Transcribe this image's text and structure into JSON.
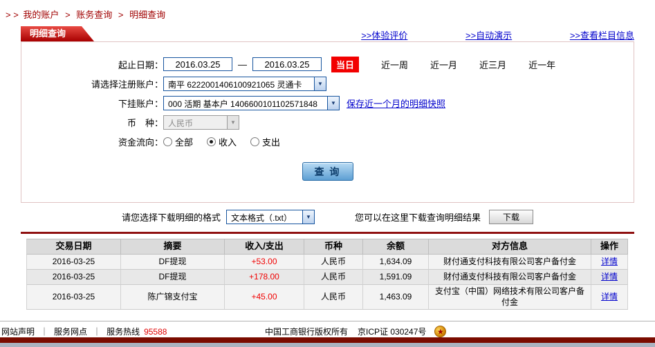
{
  "icons": {
    "dropdown_arrow": "▼",
    "badge_star": "★"
  },
  "breadcrumb": {
    "prefix": "> >",
    "separator": ">",
    "items": [
      "我的账户",
      "账务查询",
      "明细查询"
    ]
  },
  "panel": {
    "title": "明细查询",
    "links": [
      ">>体验评价",
      ">>自动演示",
      ">>查看栏目信息"
    ]
  },
  "form": {
    "date_label": "起止日期：",
    "date_from": "2016.03.25",
    "date_to": "2016.03.25",
    "dash": "—",
    "today_button": "当日",
    "quick_ranges": [
      "近一周",
      "近一月",
      "近三月",
      "近一年"
    ],
    "account_label": "请选择注册账户：",
    "account_value": "南平 6222001406100921065 灵通卡",
    "subaccount_label": "下挂账户：",
    "subaccount_value": "000 活期 基本户 1406600101102571848",
    "snapshot_link": "保存近一个月的明细快照",
    "currency_label": "币　种：",
    "currency_value": "人民币",
    "flow_label": "资金流向：",
    "flow_options": [
      "全部",
      "收入",
      "支出"
    ],
    "flow_selected": "收入",
    "query_button": "查 询"
  },
  "download": {
    "format_label": "请您选择下载明细的格式",
    "format_value": "文本格式（.txt）",
    "hint": "您可以在这里下载查询明细结果",
    "button": "下载"
  },
  "table": {
    "headers": [
      "交易日期",
      "摘要",
      "收入/支出",
      "币种",
      "余额",
      "对方信息",
      "操作"
    ],
    "rows": [
      {
        "date": "2016-03-25",
        "summary": "DF提现",
        "amount": "+53.00",
        "currency": "人民币",
        "balance": "1,634.09",
        "counterparty": "财付通支付科技有限公司客户备付金",
        "action": "详情"
      },
      {
        "date": "2016-03-25",
        "summary": "DF提现",
        "amount": "+178.00",
        "currency": "人民币",
        "balance": "1,591.09",
        "counterparty": "财付通支付科技有限公司客户备付金",
        "action": "详情"
      },
      {
        "date": "2016-03-25",
        "summary": "陈广锦支付宝",
        "amount": "+45.00",
        "currency": "人民币",
        "balance": "1,463.09",
        "counterparty": "支付宝（中国）网络技术有限公司客户备付金",
        "action": "详情"
      }
    ]
  },
  "footer": {
    "links": [
      "网站声明",
      "服务网点"
    ],
    "separator": "｜",
    "hotline_label": "服务热线",
    "hotline_number": "95588",
    "copyright": "中国工商银行版权所有",
    "icp": "京ICP证 030247号"
  }
}
